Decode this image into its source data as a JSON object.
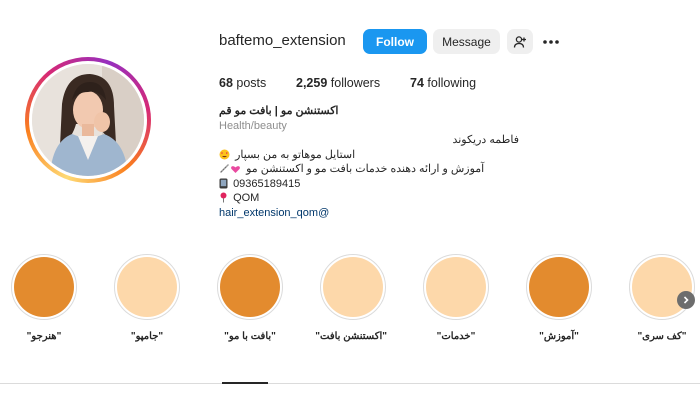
{
  "profile": {
    "username": "baftemo_extension",
    "follow_label": "Follow",
    "message_label": "Message",
    "add_user_icon": "add-user-icon",
    "more_icon": "more-horizontal-icon"
  },
  "stats": {
    "posts_count": "68",
    "posts_label": "posts",
    "followers_count": "2,259",
    "followers_label": "followers",
    "following_count": "74",
    "following_label": "following"
  },
  "bio": {
    "name": "اکستنشن مو | بافت مو قم",
    "category": "Health/beauty",
    "line1": "فاطمه دریکوند",
    "line2": "استایل موهاتو به من بسپار",
    "line2_emoji": "heart-eyes-emoji",
    "line3": "آموزش و ارائه دهنده خدمات بافت مو و اکستنشن مو",
    "line3_emoji": "comb-and-heart-emoji",
    "phone": "09365189415",
    "phone_icon": "mobile-phone-icon",
    "location": "QOM",
    "location_icon": "pushpin-icon",
    "link": "hair_extension_qom@"
  },
  "highlights": [
    {
      "label": "\"هنرجو\"",
      "color": "#e38b2e"
    },
    {
      "label": "\"جامپو\"",
      "color": "#fdd8aa"
    },
    {
      "label": "\"بافت با مو\"",
      "color": "#e38b2e"
    },
    {
      "label": "\"اکستنشن بافت\"",
      "color": "#fdd8aa"
    },
    {
      "label": "\"خدمات\"",
      "color": "#fdd8aa"
    },
    {
      "label": "\"آموزش\"",
      "color": "#e38b2e"
    },
    {
      "label": "\"کف سری\"",
      "color": "#fdd8aa"
    }
  ],
  "colors": {
    "follow_button": "#1a97f0",
    "highlight_dark": "#e38b2e",
    "highlight_light": "#fdd8aa",
    "link": "#00376b"
  }
}
